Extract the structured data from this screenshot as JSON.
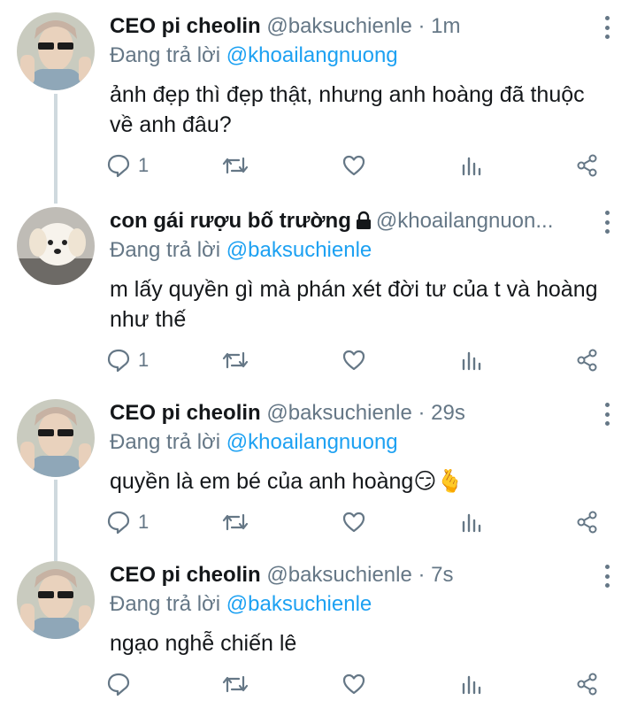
{
  "tweets": [
    {
      "name": "CEO pi cheolin",
      "handle": "@baksuchienle",
      "separator": "·",
      "time": "1m",
      "reply_prefix": "Đang trả lời",
      "reply_to": "@khoailangnuong",
      "text": "ảnh đẹp thì đẹp thật, nhưng anh hoàng đã thuộc về anh đâu?",
      "reply_count": "1"
    },
    {
      "name": "con gái rượu bố trường",
      "handle": "@khoailangnuon...",
      "reply_prefix": "Đang trả lời",
      "reply_to": "@baksuchienle",
      "text": "m lấy quyền gì mà phán xét đời tư của t và hoàng như thế",
      "reply_count": "1",
      "badge_icon": "lock-icon"
    },
    {
      "name": "CEO pi cheolin",
      "handle": "@baksuchienle",
      "separator": "·",
      "time": "29s",
      "reply_prefix": "Đang trả lời",
      "reply_to": "@khoailangnuong",
      "text": "quyền là em bé của anh hoàng😏🫰",
      "reply_count": "1"
    },
    {
      "name": "CEO pi cheolin",
      "handle": "@baksuchienle",
      "separator": "·",
      "time": "7s",
      "reply_prefix": "Đang trả lời",
      "reply_to": "@baksuchienle",
      "text": "ngạo nghễ chiến lê",
      "reply_count": ""
    }
  ],
  "icons": [
    "reply-icon",
    "retweet-icon",
    "like-icon",
    "views-icon",
    "share-icon",
    "more-icon"
  ],
  "colors": {
    "text": "#14171a",
    "secondary": "#657786",
    "mention": "#1da1f2",
    "thread": "#cfd9de"
  }
}
